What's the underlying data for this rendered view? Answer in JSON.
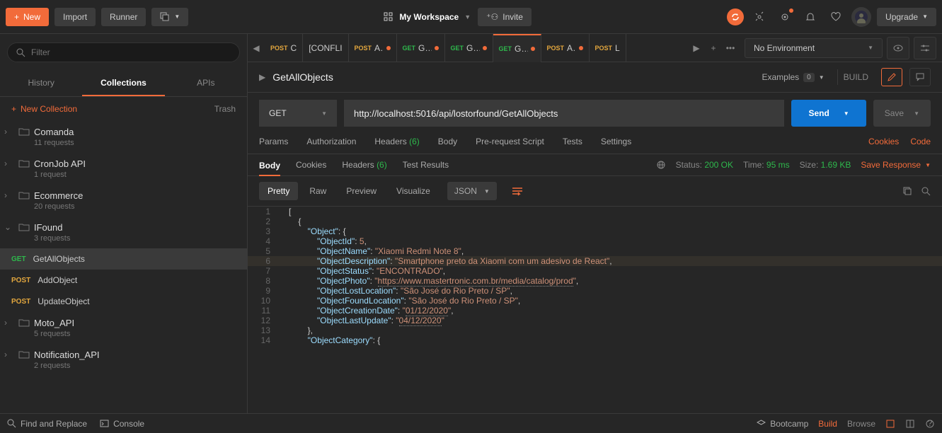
{
  "topbar": {
    "new": "New",
    "import": "Import",
    "runner": "Runner",
    "workspace": "My Workspace",
    "invite": "Invite",
    "upgrade": "Upgrade"
  },
  "sidebar": {
    "filter_placeholder": "Filter",
    "tabs": {
      "history": "History",
      "collections": "Collections",
      "apis": "APIs"
    },
    "new_collection": "New Collection",
    "trash": "Trash",
    "collections": [
      {
        "name": "Comanda",
        "count": "11 requests",
        "opened": false
      },
      {
        "name": "CronJob API",
        "count": "1 request",
        "opened": false
      },
      {
        "name": "Ecommerce",
        "count": "20 requests",
        "opened": false
      },
      {
        "name": "IFound",
        "count": "3 requests",
        "opened": true
      },
      {
        "name": "Moto_API",
        "count": "5 requests",
        "opened": false
      },
      {
        "name": "Notification_API",
        "count": "2 requests",
        "opened": false
      }
    ],
    "ifound_requests": [
      {
        "method": "GET",
        "mclass": "get",
        "name": "GetAllObjects",
        "active": true
      },
      {
        "method": "POST",
        "mclass": "post",
        "name": "AddObject",
        "active": false
      },
      {
        "method": "POST",
        "mclass": "post",
        "name": "UpdateObject",
        "active": false
      }
    ]
  },
  "tabs": [
    {
      "method": "POST",
      "mclass": "post",
      "label": "C",
      "dot": false
    },
    {
      "plain": true,
      "label": "[CONFLI"
    },
    {
      "method": "POST",
      "mclass": "post",
      "label": "A..",
      "dot": true
    },
    {
      "method": "GET",
      "mclass": "get",
      "label": "G...",
      "dot": true
    },
    {
      "method": "GET",
      "mclass": "get",
      "label": "G...",
      "dot": true
    },
    {
      "method": "GET",
      "mclass": "get",
      "label": "G...",
      "dot": true,
      "active": true
    },
    {
      "method": "POST",
      "mclass": "post",
      "label": "A..",
      "dot": true
    },
    {
      "method": "POST",
      "mclass": "post",
      "label": "L",
      "dot": false
    }
  ],
  "environment": "No Environment",
  "request": {
    "title": "GetAllObjects",
    "examples_label": "Examples",
    "examples_count": "0",
    "build": "BUILD",
    "method": "GET",
    "url": "http://localhost:5016/api/lostorfound/GetAllObjects",
    "send": "Send",
    "save": "Save",
    "subtabs": {
      "params": "Params",
      "auth": "Authorization",
      "headers": "Headers",
      "headers_count": "(6)",
      "body": "Body",
      "prereq": "Pre-request Script",
      "tests": "Tests",
      "settings": "Settings",
      "cookies": "Cookies",
      "code": "Code"
    }
  },
  "response": {
    "tabs": {
      "body": "Body",
      "cookies": "Cookies",
      "headers": "Headers",
      "headers_count": "(6)",
      "tests": "Test Results"
    },
    "status_label": "Status:",
    "status_value": "200 OK",
    "time_label": "Time:",
    "time_value": "95 ms",
    "size_label": "Size:",
    "size_value": "1.69 KB",
    "save_response": "Save Response",
    "view": {
      "pretty": "Pretty",
      "raw": "Raw",
      "preview": "Preview",
      "visualize": "Visualize",
      "format": "JSON"
    }
  },
  "json_body": {
    "ObjectId": 5,
    "ObjectName": "Xiaomi Redmi Note 8",
    "ObjectDescription": "Smartphone preto da Xiaomi com um adesivo de React",
    "ObjectStatus": "ENCONTRADO",
    "ObjectPhoto": "https://www.mastertronic.com.br/media/catalog/prod",
    "ObjectLostLocation": "São José do Rio Preto / SP",
    "ObjectFoundLocation": "São José do Rio Preto / SP",
    "ObjectCreationDate": "01/12/2020",
    "ObjectLastUpdate": "04/12/2020"
  },
  "footer": {
    "find": "Find and Replace",
    "console": "Console",
    "bootcamp": "Bootcamp",
    "build": "Build",
    "browse": "Browse"
  }
}
